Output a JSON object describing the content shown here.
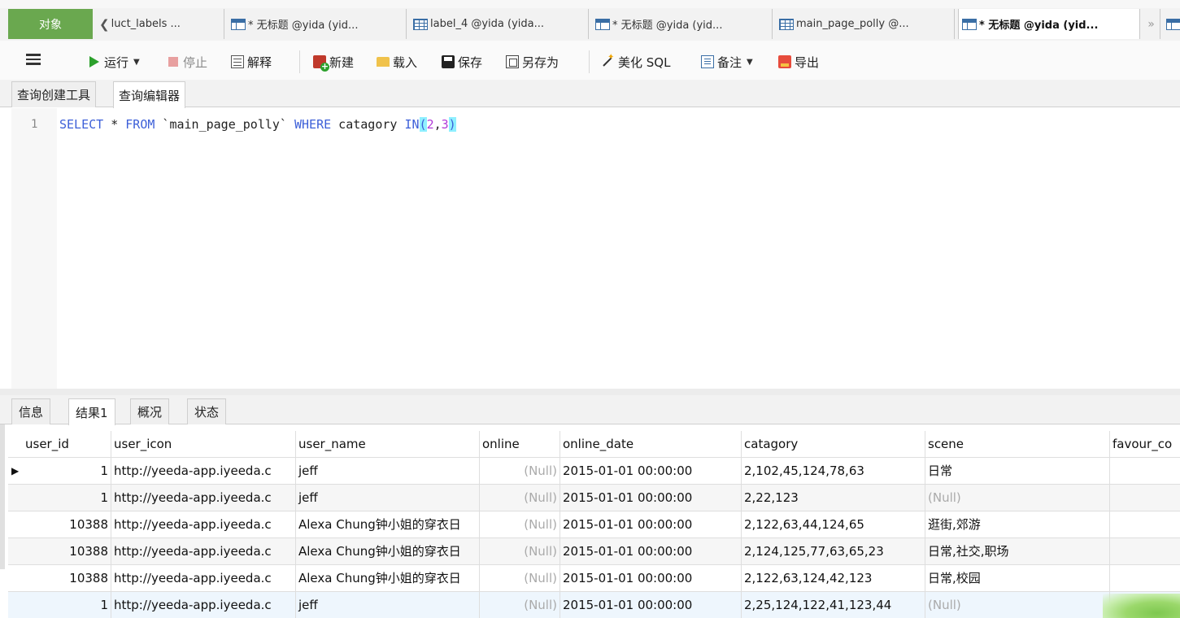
{
  "tabstrip": {
    "object_tab": "对象",
    "tabs": [
      {
        "label": "luct_labels ...",
        "icon": "back-arrow",
        "active": false
      },
      {
        "label": "* 无标题 @yida (yid...",
        "icon": "query-icon",
        "active": false
      },
      {
        "label": "label_4 @yida (yida...",
        "icon": "table-icon",
        "active": false
      },
      {
        "label": "* 无标题 @yida (yid...",
        "icon": "query-icon",
        "active": false
      },
      {
        "label": "main_page_polly @...",
        "icon": "table-icon",
        "active": false
      },
      {
        "label": "* 无标题 @yida (yid...",
        "icon": "query-icon",
        "active": true
      }
    ],
    "more": "»"
  },
  "toolbar": {
    "run": "运行",
    "stop": "停止",
    "explain": "解释",
    "new": "新建",
    "load": "载入",
    "save": "保存",
    "save_as": "另存为",
    "beautify": "美化 SQL",
    "comment": "备注",
    "export": "导出"
  },
  "subtabs": [
    "查询创建工具",
    "查询编辑器"
  ],
  "editor": {
    "line_number": "1",
    "sql": {
      "select": "SELECT",
      "star_from_pre": " * ",
      "from": "FROM",
      "table": " `main_page_polly` ",
      "where": "WHERE",
      "col": " catagory ",
      "in": "IN",
      "open": "(",
      "v1": "2",
      "comma": ",",
      "v2": "3",
      "close": ")"
    }
  },
  "result_tabs": [
    "信息",
    "结果1",
    "概况",
    "状态"
  ],
  "grid": {
    "columns": [
      "user_id",
      "user_icon",
      "user_name",
      "online",
      "online_date",
      "catagory",
      "scene",
      "favour_co"
    ],
    "rows": [
      [
        "1",
        "http://yeeda-app.iyeeda.c",
        "jeff",
        "(Null)",
        "2015-01-01 00:00:00",
        "2,102,45,124,78,63",
        "日常",
        ""
      ],
      [
        "1",
        "http://yeeda-app.iyeeda.c",
        "jeff",
        "(Null)",
        "2015-01-01 00:00:00",
        "2,22,123",
        "(Null)",
        ""
      ],
      [
        "10388",
        "http://yeeda-app.iyeeda.c",
        "Alexa Chung钟小姐的穿衣日",
        "(Null)",
        "2015-01-01 00:00:00",
        "2,122,63,44,124,65",
        "逛街,郊游",
        ""
      ],
      [
        "10388",
        "http://yeeda-app.iyeeda.c",
        "Alexa Chung钟小姐的穿衣日",
        "(Null)",
        "2015-01-01 00:00:00",
        "2,124,125,77,63,65,23",
        "日常,社交,职场",
        ""
      ],
      [
        "10388",
        "http://yeeda-app.iyeeda.c",
        "Alexa Chung钟小姐的穿衣日",
        "(Null)",
        "2015-01-01 00:00:00",
        "2,122,63,124,42,123",
        "日常,校园",
        ""
      ],
      [
        "1",
        "http://yeeda-app.iyeeda.c",
        "jeff",
        "(Null)",
        "2015-01-01 00:00:00",
        "2,25,124,122,41,123,44",
        "(Null)",
        ""
      ]
    ]
  },
  "colors": {
    "object_tab_bg": "#6aa84f",
    "keyword": "#3c5fd8",
    "number": "#b03ad8",
    "bracket_highlight": "#8ff0ff",
    "null_text": "#aaaaaa"
  }
}
